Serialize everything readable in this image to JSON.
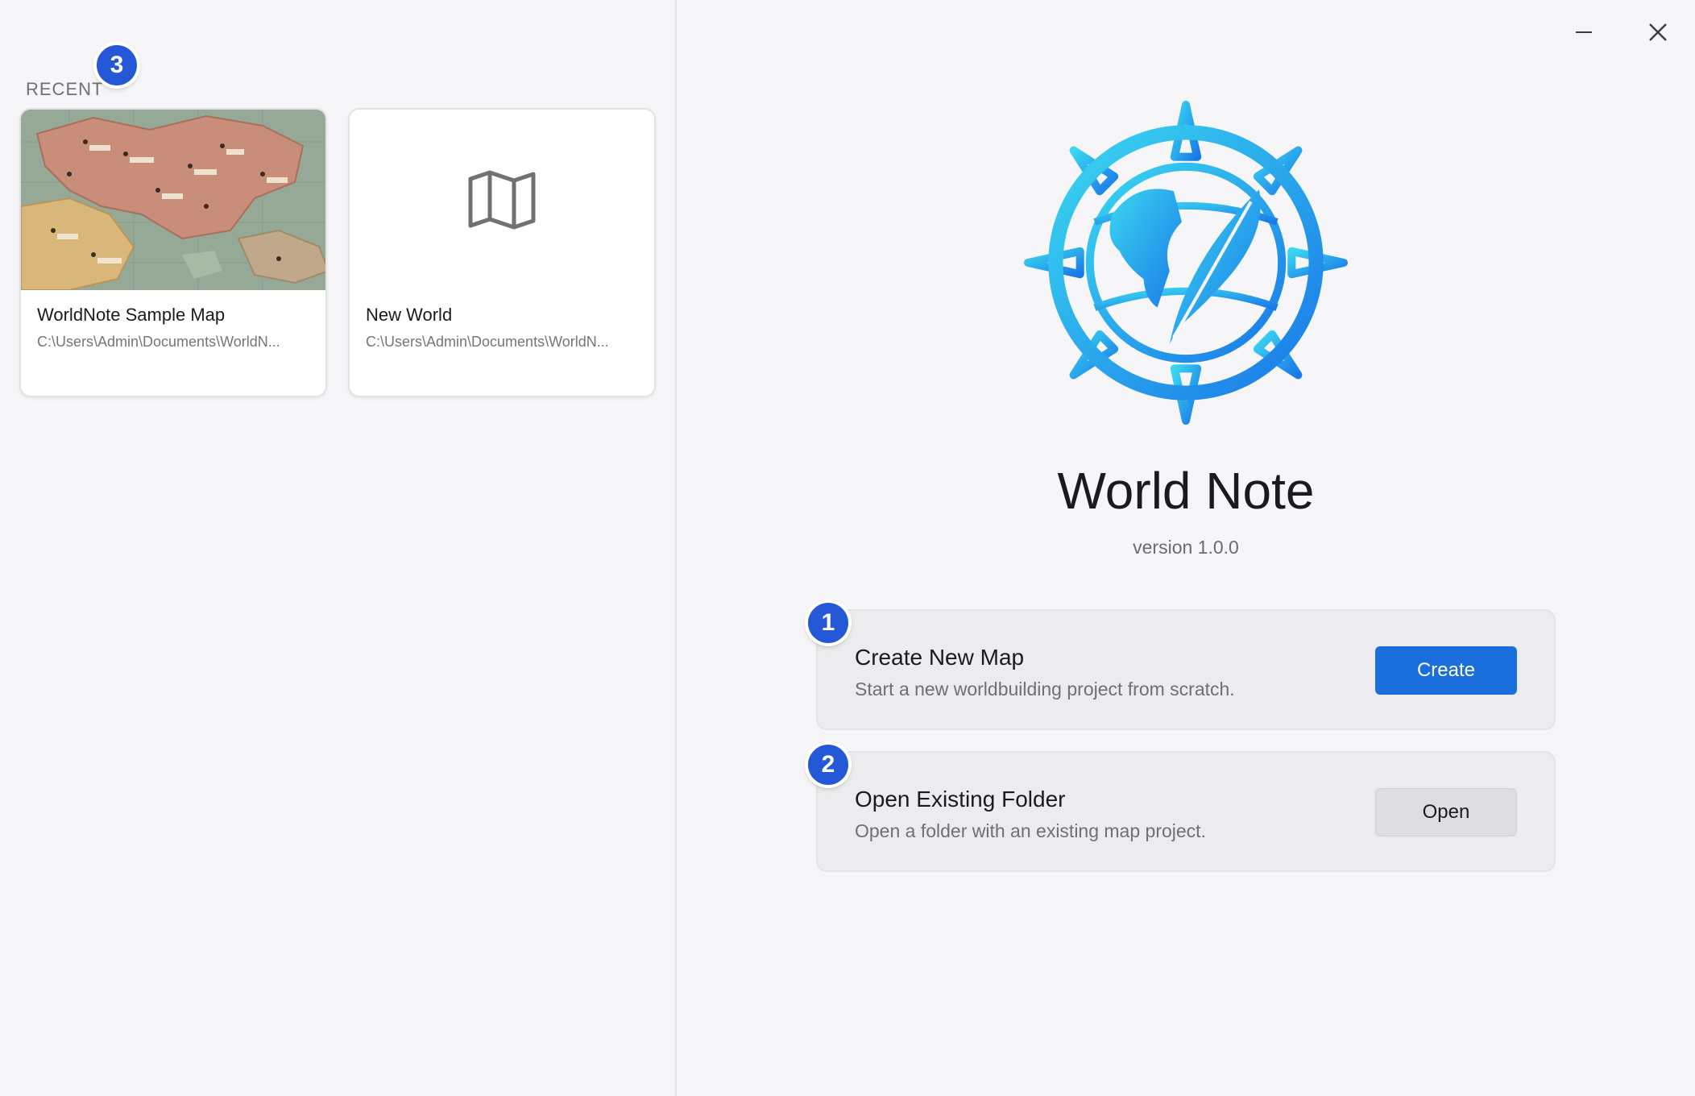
{
  "recent": {
    "label": "RECENT",
    "badge": "3",
    "cards": [
      {
        "title": "WorldNote Sample Map",
        "path": "C:\\Users\\Admin\\Documents\\WorldN...",
        "thumbnail": "map-preview"
      },
      {
        "title": "New World",
        "path": "C:\\Users\\Admin\\Documents\\WorldN...",
        "thumbnail": "map-icon"
      }
    ]
  },
  "window": {
    "minimize_icon": "minimize-icon",
    "close_icon": "close-icon"
  },
  "app": {
    "title": "World Note",
    "version": "version 1.0.0",
    "logo_icon": "compass-globe-quill-icon"
  },
  "actions": [
    {
      "badge": "1",
      "title": "Create New Map",
      "desc": "Start a new worldbuilding project from scratch.",
      "button": "Create"
    },
    {
      "badge": "2",
      "title": "Open Existing Folder",
      "desc": "Open a folder with an existing map project.",
      "button": "Open"
    }
  ],
  "colors": {
    "accent": "#1a6fdc",
    "badge": "#2458d6",
    "background": "#f6f6f8",
    "logo_light": "#3ad7f0",
    "logo_dark": "#1a78e8"
  }
}
